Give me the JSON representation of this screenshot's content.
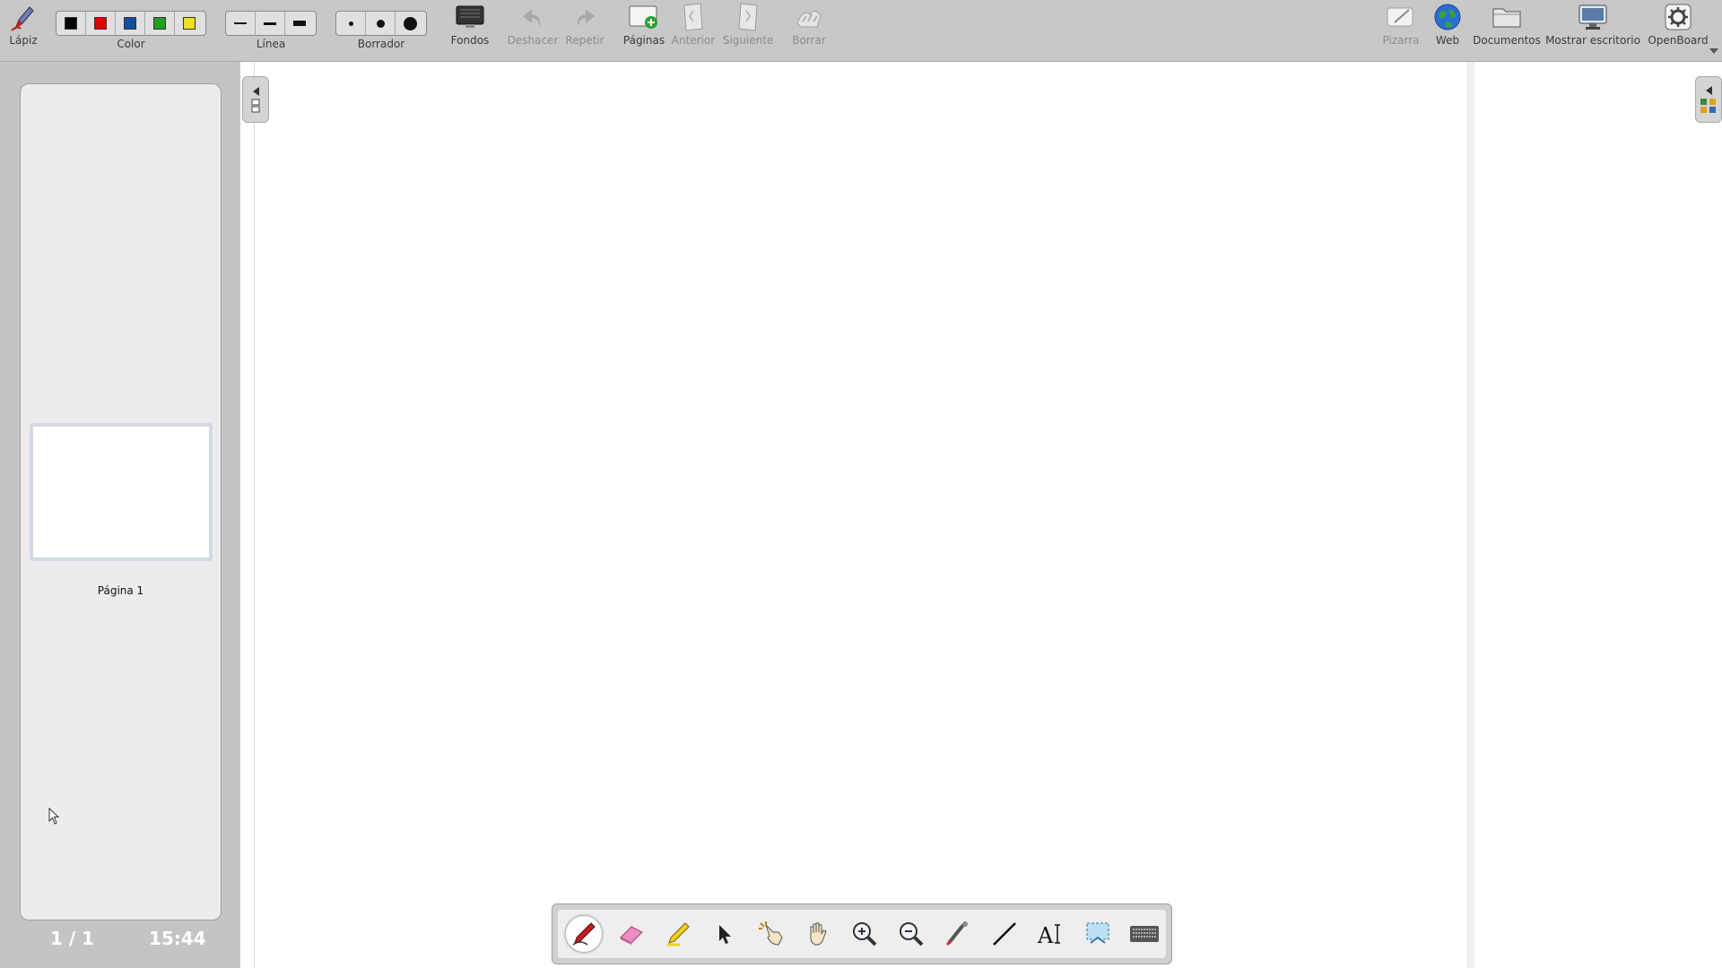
{
  "toolbar": {
    "pen_label": "Lápiz",
    "color_label": "Color",
    "colors": [
      "#000000",
      "#e00000",
      "#1050a0",
      "#20a020",
      "#f0e020"
    ],
    "line_label": "Línea",
    "eraser_label": "Borrador",
    "backgrounds_label": "Fondos",
    "undo_label": "Deshacer",
    "redo_label": "Repetir",
    "pages_label": "Páginas",
    "prev_label": "Anterior",
    "next_label": "Siguiente",
    "clear_label": "Borrar",
    "board_label": "Pizarra",
    "web_label": "Web",
    "documents_label": "Documentos",
    "desktop_label": "Mostrar escritorio",
    "openboard_label": "OpenBoard"
  },
  "sidebar": {
    "thumbnail_label": "Página 1",
    "page_counter": "1 / 1",
    "clock": "15:44"
  },
  "bottom_tools": [
    "pen-tool",
    "eraser-tool",
    "highlighter-tool",
    "selector-tool",
    "interact-tool",
    "hand-tool",
    "zoom-in-tool",
    "zoom-out-tool",
    "laser-pointer-tool",
    "line-tool",
    "text-tool",
    "capture-tool",
    "keyboard-tool"
  ],
  "active_tool": "pen-tool"
}
